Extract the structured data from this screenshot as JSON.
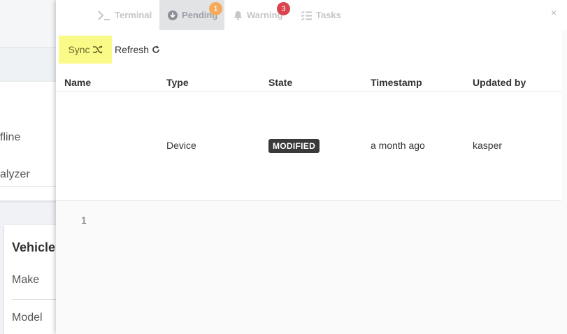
{
  "background": {
    "field_offline": "fline",
    "field_analyzer": "alyzer",
    "vehicle_title": "Vehicle",
    "make_label": "Make",
    "model_label": "Model"
  },
  "tabs": [
    {
      "label": "Terminal",
      "icon": "terminal-icon"
    },
    {
      "label": "Pending",
      "icon": "download-circle-icon",
      "badge": "1",
      "active": true
    },
    {
      "label": "Warning",
      "icon": "bell-icon",
      "badge": "3"
    },
    {
      "label": "Tasks",
      "icon": "tasks-icon"
    }
  ],
  "close_label": "×",
  "toolbar": {
    "sync_label": "Sync",
    "refresh_label": "Refresh"
  },
  "table": {
    "columns": [
      "Name",
      "Type",
      "State",
      "Timestamp",
      "Updated by"
    ],
    "rows": [
      {
        "name": "",
        "type": "Device",
        "state": "MODIFIED",
        "timestamp": "a month ago",
        "updated_by": "kasper"
      }
    ]
  },
  "pagination": {
    "page": "1"
  },
  "colors": {
    "sync_highlight": "#fafa88",
    "badge_orange": "#f5a95a",
    "badge_red": "#d9434e",
    "state_badge": "#3a3a3a"
  }
}
